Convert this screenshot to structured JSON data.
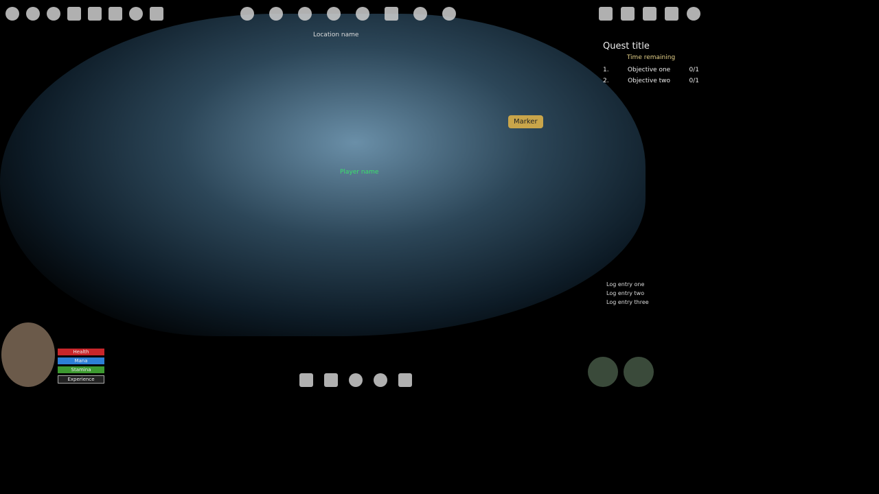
{
  "location": "Location name",
  "quest": {
    "title": "Quest title",
    "timer": "Time remaining",
    "objectives": [
      {
        "index": "1.",
        "text": "Objective one",
        "progress": "0/1"
      },
      {
        "index": "2.",
        "text": "Objective two",
        "progress": "0/1"
      }
    ]
  },
  "player": {
    "name": "Player name",
    "health": "Health",
    "mana": "Mana",
    "stamina": "Stamina",
    "experience": "Experience"
  },
  "marker_label": "Marker",
  "chat_log": [
    "Log entry one",
    "Log entry two",
    "Log entry three"
  ]
}
